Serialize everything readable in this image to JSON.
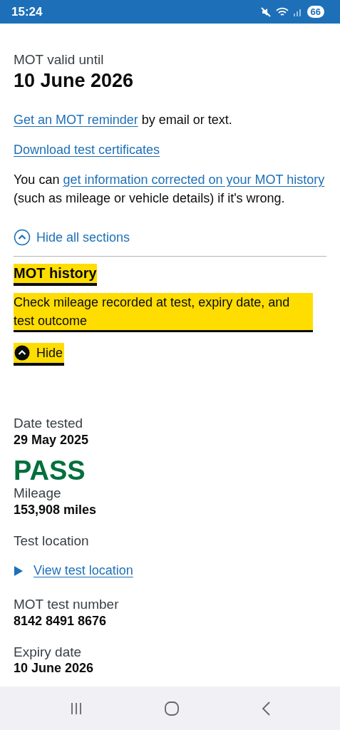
{
  "status_bar": {
    "time": "15:24",
    "battery": "66"
  },
  "summary": {
    "label": "MOT valid until",
    "value": "10 June 2026"
  },
  "reminder": {
    "link": "Get an MOT reminder",
    "text": " by email or text."
  },
  "download_link": "Download test certificates",
  "correction": {
    "before": "You can ",
    "link": "get information corrected on your MOT history",
    "after": " (such as mileage or vehicle details) if it's wrong."
  },
  "accordion": {
    "toggle_all": "Hide all sections",
    "expanded": true,
    "section": {
      "heading": "MOT history",
      "summary": "Check mileage recorded at test, expiry date, and test outcome",
      "toggle": "Hide",
      "focused": true,
      "expanded": true
    }
  },
  "test": {
    "date_label": "Date tested",
    "date": "29 May 2025",
    "result": "PASS",
    "kind": "pass",
    "mileage_label": "Mileage",
    "mileage": "153,908 miles",
    "location_label": "Test location",
    "location_link": "View test location",
    "number_label": "MOT test number",
    "number": "8142 8491 8676",
    "expiry_label": "Expiry date",
    "expiry": "10 June 2026"
  }
}
